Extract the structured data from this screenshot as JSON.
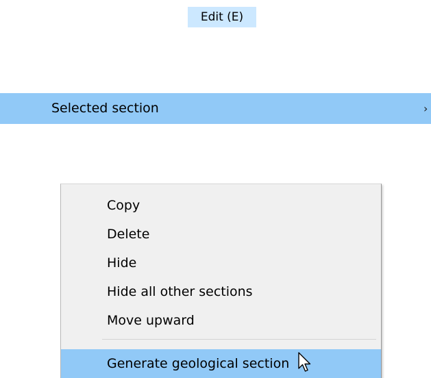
{
  "menubar": {
    "edit_label": "Edit (E)"
  },
  "submenu_row": {
    "label": "Selected section",
    "arrow": "›"
  },
  "context_menu": {
    "items": [
      {
        "label": "Copy"
      },
      {
        "label": "Delete"
      },
      {
        "label": "Hide"
      },
      {
        "label": "Hide all other sections"
      },
      {
        "label": "Move upward"
      },
      {
        "label": "Generate geological section"
      }
    ],
    "highlighted_item": "Generate geological section"
  },
  "colors": {
    "menubar_highlight": "#cce8ff",
    "selection_highlight": "#91c9f7",
    "menu_background": "#f0f0f0"
  },
  "icons": {
    "cursor": "arrow-pointer-icon",
    "submenu_arrow": "chevron-right-icon"
  }
}
